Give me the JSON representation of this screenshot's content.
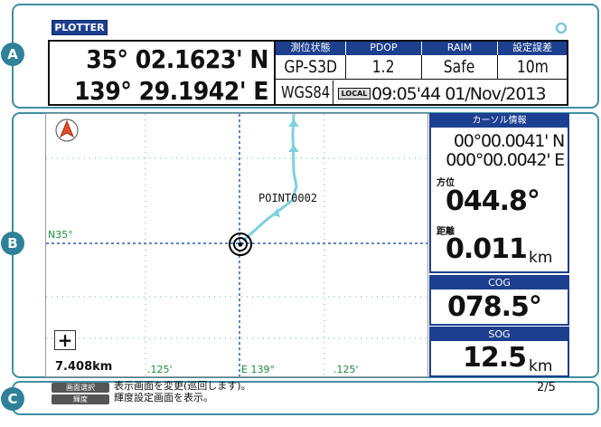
{
  "markers": {
    "a": "A",
    "b": "B",
    "c": "C"
  },
  "header": {
    "mode_badge": "PLOTTER",
    "lat": "35° 02.1623' N",
    "lon": "139° 29.1942' E",
    "columns": [
      {
        "label": "測位状態",
        "value": "GP-S3D"
      },
      {
        "label": "PDOP",
        "value": "1.2"
      },
      {
        "label": "RAIM",
        "value": "Safe"
      },
      {
        "label": "設定誤差",
        "value": "10m"
      }
    ],
    "datum": "WGS84",
    "local_badge": "LOCAL",
    "datetime": "09:05'44 01/Nov/2013"
  },
  "plot": {
    "point_label": "POINT0002",
    "lat_label": "N35°",
    "lon_label": "E 139°",
    "grid_label_left": ".125'",
    "grid_label_right": ".125'",
    "scale": "7.408km",
    "zoom_symbol": "+"
  },
  "cursor_info": {
    "title": "カーソル情報",
    "lat": "00°00.0041' N",
    "lon": "000°00.0042' E",
    "bearing_label": "方位",
    "bearing_value": "044.8°",
    "distance_label": "距離",
    "distance_value": "0.011",
    "distance_unit": "km"
  },
  "cog": {
    "label": "COG",
    "value": "078.5°"
  },
  "sog": {
    "label": "SOG",
    "value": "12.5",
    "unit": "km"
  },
  "footer": {
    "key1": "画面選択",
    "desc1": "表示画面を変更(巡回します)。",
    "key2": "輝度",
    "desc2": "輝度設定画面を表示。",
    "page": "2/5"
  },
  "colors": {
    "frame": "#3d8fa3",
    "header_blue": "#1c3f8f",
    "track": "#7fd0de",
    "grid": "#2a5fb0"
  }
}
